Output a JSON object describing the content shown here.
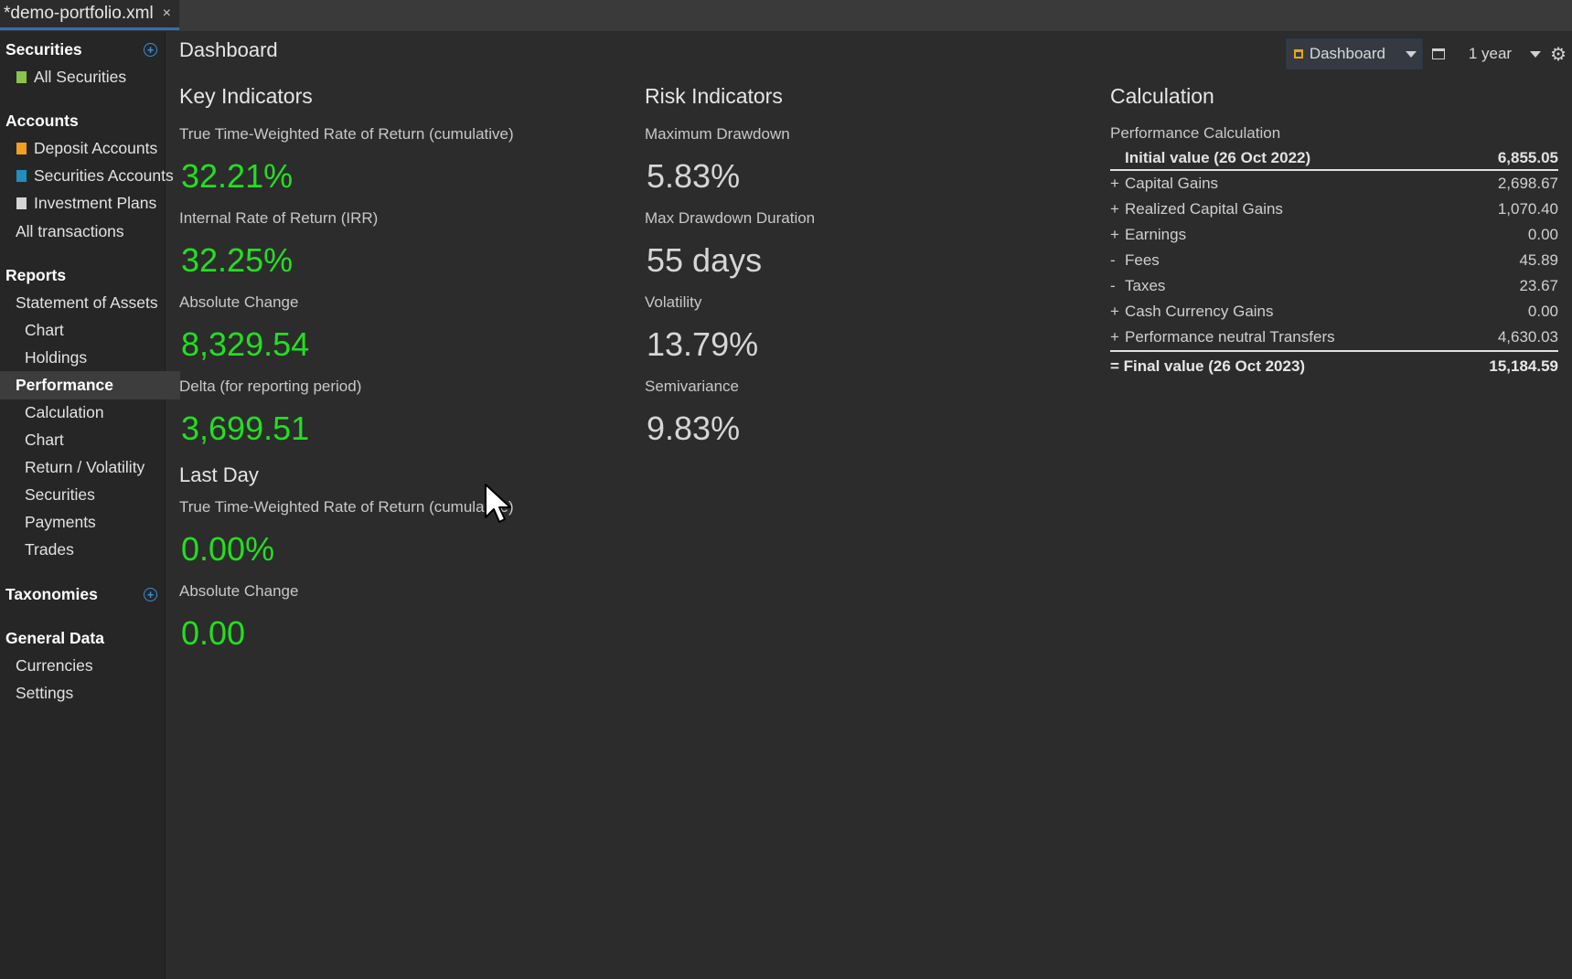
{
  "tab": {
    "title": "*demo-portfolio.xml",
    "close": "×"
  },
  "sidebar": {
    "securities_header": "Securities",
    "all_securities": "All Securities",
    "accounts_header": "Accounts",
    "deposit_accounts": "Deposit Accounts",
    "securities_accounts": "Securities Accounts",
    "investment_plans": "Investment Plans",
    "all_transactions": "All transactions",
    "reports_header": "Reports",
    "statement_of_assets": "Statement of Assets",
    "soa_chart": "Chart",
    "soa_holdings": "Holdings",
    "performance": "Performance",
    "perf_calculation": "Calculation",
    "perf_chart": "Chart",
    "perf_return_volatility": "Return / Volatility",
    "perf_securities": "Securities",
    "perf_payments": "Payments",
    "perf_trades": "Trades",
    "taxonomies_header": "Taxonomies",
    "general_data_header": "General Data",
    "currencies": "Currencies",
    "settings": "Settings",
    "colors": {
      "all_securities": "#8bc34a",
      "deposit": "#f0a01e",
      "securities_account": "#1f8fc0",
      "investment_plans": "#d6d6d6"
    }
  },
  "main": {
    "title": "Dashboard",
    "toolbar": {
      "dashboard_label": "Dashboard",
      "period_label": "1 year",
      "gear": "⚙"
    },
    "key_indicators": {
      "heading": "Key Indicators",
      "items": [
        {
          "label": "True Time-Weighted Rate of Return (cumulative)",
          "value": "32.21%"
        },
        {
          "label": "Internal Rate of Return (IRR)",
          "value": "32.25%"
        },
        {
          "label": "Absolute Change",
          "value": "8,329.54"
        },
        {
          "label": "Delta (for reporting period)",
          "value": "3,699.51"
        }
      ]
    },
    "last_day": {
      "heading": "Last Day",
      "items": [
        {
          "label": "True Time-Weighted Rate of Return (cumulative)",
          "value": "0.00%"
        },
        {
          "label": "Absolute Change",
          "value": "0.00"
        }
      ]
    },
    "risk_indicators": {
      "heading": "Risk Indicators",
      "items": [
        {
          "label": "Maximum Drawdown",
          "value": "5.83%"
        },
        {
          "label": "Max Drawdown Duration",
          "value": "55 days"
        },
        {
          "label": "Volatility",
          "value": "13.79%"
        },
        {
          "label": "Semivariance",
          "value": "9.83%"
        }
      ]
    },
    "calculation": {
      "heading": "Calculation",
      "sub_label": "Performance Calculation",
      "initial": {
        "label": "Initial value (26 Oct 2022)",
        "value": "6,855.05"
      },
      "rows": [
        {
          "op": "+",
          "label": "Capital Gains",
          "value": "2,698.67"
        },
        {
          "op": "+",
          "label": "Realized Capital Gains",
          "value": "1,070.40"
        },
        {
          "op": "+",
          "label": "Earnings",
          "value": "0.00"
        },
        {
          "op": "-",
          "label": "Fees",
          "value": "45.89"
        },
        {
          "op": "-",
          "label": "Taxes",
          "value": "23.67"
        },
        {
          "op": "+",
          "label": "Cash Currency Gains",
          "value": "0.00"
        },
        {
          "op": "+",
          "label": "Performance neutral Transfers",
          "value": "4,630.03"
        }
      ],
      "final": {
        "label": "= Final value (26 Oct 2023)",
        "value": "15,184.59"
      }
    }
  },
  "colors": {
    "positive": "#22e01e",
    "accent": "#2e6fb5",
    "background": "#2c2c2c"
  }
}
